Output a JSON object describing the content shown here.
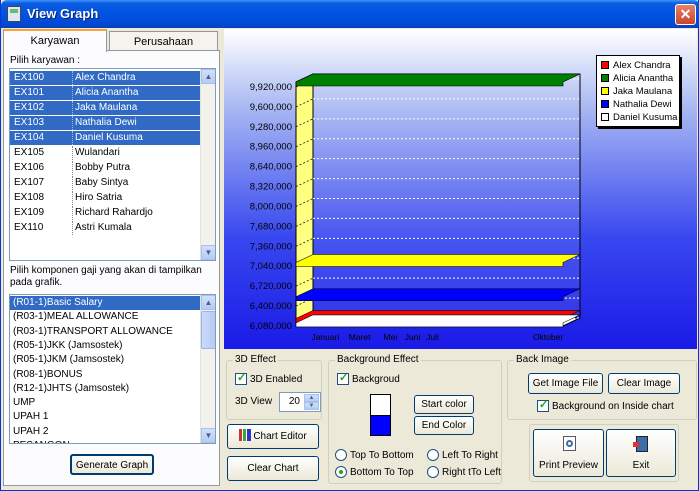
{
  "window": {
    "title": "View Graph",
    "close_glyph": "✕"
  },
  "tabs": [
    "Karyawan",
    "Perusahaan"
  ],
  "employee_section": {
    "label": "Pilih karyawan :",
    "rows": [
      {
        "code": "EX100",
        "name": "Alex Chandra",
        "selected": true
      },
      {
        "code": "EX101",
        "name": "Alicia Anantha",
        "selected": true
      },
      {
        "code": "EX102",
        "name": "Jaka Maulana",
        "selected": true
      },
      {
        "code": "EX103",
        "name": "Nathalia Dewi",
        "selected": true
      },
      {
        "code": "EX104",
        "name": "Daniel Kusuma",
        "selected": true
      },
      {
        "code": "EX105",
        "name": "Wulandari",
        "selected": false
      },
      {
        "code": "EX106",
        "name": "Bobby Putra",
        "selected": false
      },
      {
        "code": "EX107",
        "name": "Baby Sintya",
        "selected": false
      },
      {
        "code": "EX108",
        "name": "Hiro Satria",
        "selected": false
      },
      {
        "code": "EX109",
        "name": "Richard Rahardjo",
        "selected": false
      },
      {
        "code": "EX110",
        "name": "Astri Kumala",
        "selected": false
      }
    ]
  },
  "component_section": {
    "label_line1": "Pilih komponen gaji yang akan di tampilkan",
    "label_line2": "pada grafik.",
    "items": [
      {
        "text": "(R01-1)Basic Salary",
        "selected": true
      },
      {
        "text": "(R03-1)MEAL ALLOWANCE",
        "selected": false
      },
      {
        "text": "(R03-1)TRANSPORT ALLOWANCE",
        "selected": false
      },
      {
        "text": "(R05-1)JKK (Jamsostek)",
        "selected": false
      },
      {
        "text": "(R05-1)JKM (Jamsostek)",
        "selected": false
      },
      {
        "text": "(R08-1)BONUS",
        "selected": false
      },
      {
        "text": "(R12-1)JHTS (Jamsostek)",
        "selected": false
      },
      {
        "text": "UMP",
        "selected": false
      },
      {
        "text": "UPAH 1",
        "selected": false
      },
      {
        "text": "UPAH 2",
        "selected": false
      },
      {
        "text": "PESANGON",
        "selected": false
      }
    ],
    "generate_button": "Generate Graph"
  },
  "chart_data": {
    "type": "line",
    "y_ticks": [
      "6,080,000",
      "6,400,000",
      "6,720,000",
      "7,040,000",
      "7,360,000",
      "7,680,000",
      "8,000,000",
      "8,320,000",
      "8,640,000",
      "8,960,000",
      "9,280,000",
      "9,600,000",
      "9,920,000"
    ],
    "ylim": [
      6080000,
      10000000
    ],
    "x_ticks": [
      "Januari",
      "Maret",
      "Mei",
      "Juni",
      "Juli",
      "Oktober"
    ],
    "series": [
      {
        "name": "Alex Chandra",
        "color": "#ff0000",
        "value": 6200000
      },
      {
        "name": "Alicia Anantha",
        "color": "#008000",
        "value": 10000000
      },
      {
        "name": "Jaka Maulana",
        "color": "#ffff00",
        "value": 7100000
      },
      {
        "name": "Nathalia Dewi",
        "color": "#0000ff",
        "value": 6550000
      },
      {
        "name": "Daniel Kusuma",
        "color": "#ffffff",
        "value": 6130000
      }
    ],
    "legend_position": "top-right"
  },
  "effect_3d": {
    "title": "3D Effect",
    "enabled_label": "3D Enabled",
    "view_label": "3D View",
    "view_value": "20"
  },
  "background_effect": {
    "title": "Background Effect",
    "background_label": "Backgroud",
    "start_color_button": "Start color",
    "end_color_button": "End Color",
    "start_color": "#ffffff",
    "end_color": "#0000ff",
    "directions": [
      "Top To Bottom",
      "Left To Right",
      "Bottom To Top",
      "Right tTo Left"
    ],
    "selected_direction": "Bottom To Top"
  },
  "back_image": {
    "title": "Back Image",
    "get_image_button": "Get Image File",
    "clear_image_button": "Clear Image",
    "inside_chart_label": "Background on Inside chart"
  },
  "buttons": {
    "chart_editor": "Chart Editor",
    "clear_chart": "Clear Chart",
    "print_preview": "Print Preview",
    "exit": "Exit"
  }
}
